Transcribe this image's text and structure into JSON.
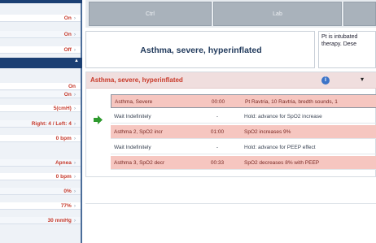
{
  "left_panel": {
    "rows": [
      {
        "value": "On"
      },
      {
        "value": "On"
      },
      {
        "value": "Off"
      },
      {
        "value": "On"
      },
      {
        "value": "On"
      },
      {
        "value": "5(cmH)"
      },
      {
        "value": "Right: 4 / Left: 4"
      },
      {
        "value": "0 bpm"
      },
      {
        "value": "Apnea"
      },
      {
        "value": "0 bpm"
      },
      {
        "value": "0%"
      },
      {
        "value": "77%"
      },
      {
        "value": "30 mmHg"
      }
    ],
    "caret": "›",
    "expand_icon": "▲",
    "footer": ""
  },
  "tabs": [
    {
      "label": "Ctrl"
    },
    {
      "label": "Lab"
    },
    {
      "label": ""
    }
  ],
  "scenario": {
    "title": "Asthma, severe, hyperinflated",
    "note": "Pt is intubated therapy. Dese"
  },
  "events": {
    "title": "Asthma, severe, hyperinflated",
    "info_icon": "i",
    "menu_icon": "▾",
    "rows": [
      {
        "state": "Asthma, Severe",
        "time": "00:00",
        "action": "Pt Ravtria, 10 Ravtria, bredth sounds, 1",
        "style": "hl"
      },
      {
        "state": "Wait Indefinitely",
        "time": "-",
        "action": "Hold: advance for SpO2 increase",
        "style": "plain"
      },
      {
        "state": "Asthma 2, SpO2 incr",
        "time": "01:00",
        "action": "SpO2 increases 9%",
        "style": "hl"
      },
      {
        "state": "Wait Indefinitely",
        "time": "-",
        "action": "Hold: advance for PEEP effect",
        "style": "plain"
      },
      {
        "state": "Asthma 3, SpO2 decr",
        "time": "00:33",
        "action": "SpO2 decreases 8% with PEEP",
        "style": "hl"
      }
    ]
  },
  "colors": {
    "accent": "#1b3f73",
    "alarm_text": "#c63a2c",
    "highlight_row": "#f6c6c0",
    "arrow": "#2e9a2e"
  }
}
